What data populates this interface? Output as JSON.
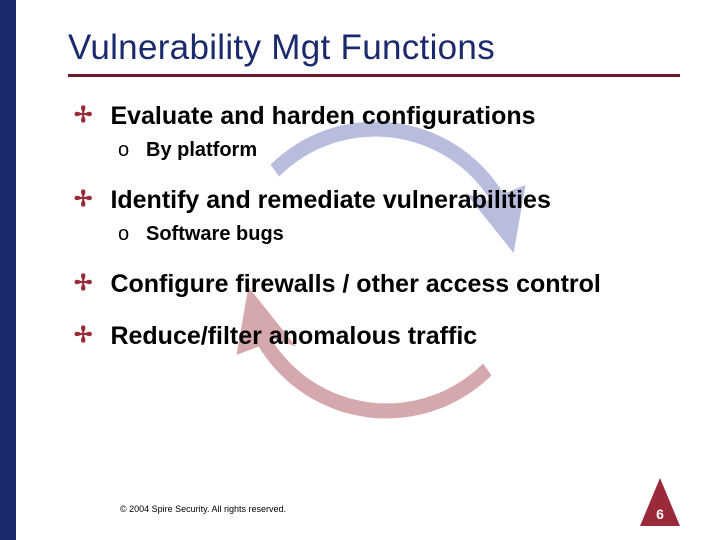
{
  "title": "Vulnerability Mgt Functions",
  "items": [
    {
      "text": "Evaluate and harden configurations",
      "sub": {
        "text": "By platform"
      }
    },
    {
      "text": "Identify and remediate vulnerabilities",
      "sub": {
        "text": "Software bugs"
      }
    },
    {
      "text": "Configure firewalls / other access control",
      "sub": null
    },
    {
      "text": "Reduce/filter anomalous traffic",
      "sub": null
    }
  ],
  "footer": "© 2004 Spire Security. All rights reserved.",
  "slide_number": "6",
  "colors": {
    "navy": "#1a2a6c",
    "maroon": "#6a1a2a",
    "accent": "#9a2a3a",
    "arrow_blue": "#b8bdde",
    "arrow_red": "#d4a8ad"
  }
}
